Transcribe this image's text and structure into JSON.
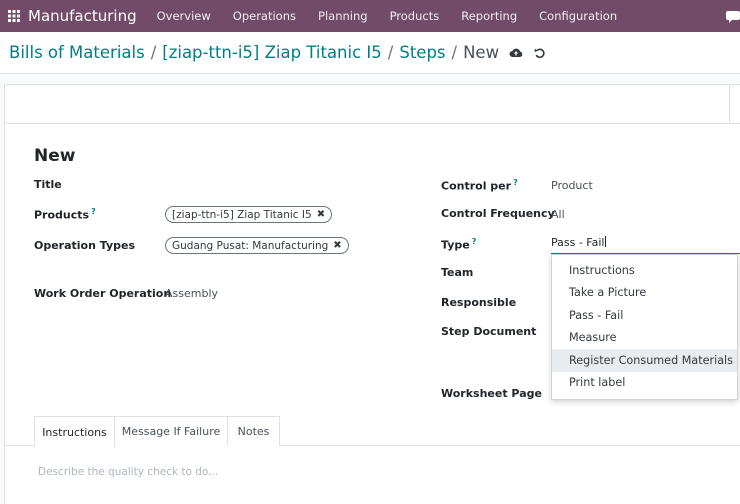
{
  "navbar": {
    "app_name": "Manufacturing",
    "menu": [
      "Overview",
      "Operations",
      "Planning",
      "Products",
      "Reporting",
      "Configuration"
    ]
  },
  "breadcrumb": {
    "items": [
      "Bills of Materials",
      "[ziap-ttn-i5] Ziap Titanic I5",
      "Steps"
    ],
    "current": "New",
    "separator": "/"
  },
  "form": {
    "record_title": "New",
    "left": {
      "title_label": "Title",
      "products_label": "Products",
      "products_tag": "[ziap-ttn-i5] Ziap Titanic I5",
      "operation_types_label": "Operation Types",
      "operation_types_tag": "Gudang Pusat: Manufacturing",
      "work_order_operation_label": "Work Order Operation",
      "work_order_operation_value": "Assembly"
    },
    "right": {
      "control_per_label": "Control per",
      "control_per_value": "Product",
      "control_frequency_label": "Control Frequency",
      "control_frequency_value": "All",
      "type_label": "Type",
      "type_value": "Pass - Fail",
      "team_label": "Team",
      "responsible_label": "Responsible",
      "step_document_label": "Step Document",
      "worksheet_page_label": "Worksheet Page"
    },
    "help_mark": "?",
    "remove_mark": "✖"
  },
  "type_dropdown": {
    "options": [
      "Instructions",
      "Take a Picture",
      "Pass - Fail",
      "Measure",
      "Register Consumed Materials",
      "Print label"
    ],
    "highlighted": "Register Consumed Materials"
  },
  "tabs": {
    "items": [
      "Instructions",
      "Message If Failure",
      "Notes"
    ],
    "active": "Instructions",
    "instructions_placeholder": "Describe the quality check to do..."
  },
  "colors": {
    "brand": "#714b67",
    "link": "#017e84"
  }
}
